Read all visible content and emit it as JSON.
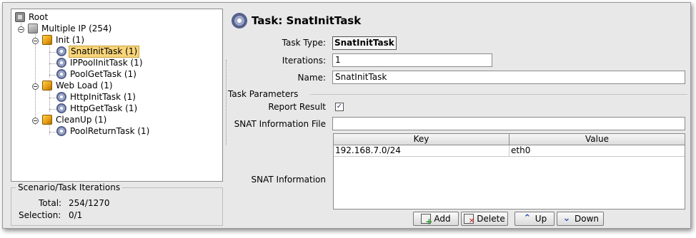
{
  "tree": {
    "root": "Root",
    "scenario": "Multiple IP (254)",
    "groups": [
      {
        "label": "Init (1)",
        "tasks": [
          "SnatInitTask (1)",
          "IPPoolInitTask (1)",
          "PoolGetTask (1)"
        ]
      },
      {
        "label": "Web Load (1)",
        "tasks": [
          "HttpInitTask (1)",
          "HttpGetTask (1)"
        ]
      },
      {
        "label": "CleanUp (1)",
        "tasks": [
          "PoolReturnTask (1)"
        ]
      }
    ],
    "selected": "SnatInitTask (1)"
  },
  "iterations_panel": {
    "title": "Scenario/Task Iterations",
    "total_label": "Total:",
    "total_value": "254/1270",
    "selection_label": "Selection:",
    "selection_value": "0/1"
  },
  "task": {
    "header": "Task: SnatInitTask",
    "type_label": "Task Type:",
    "type_value": "SnatInitTask",
    "iterations_label": "Iterations:",
    "iterations_value": "1",
    "name_label": "Name:",
    "name_value": "SnatInitTask"
  },
  "params": {
    "group_label": "Task Parameters",
    "report_result_label": "Report Result",
    "report_result_checked": true,
    "check_glyph": "✓",
    "snat_file_label": "SNAT Information File",
    "snat_file_value": "",
    "snat_info_label": "SNAT Information",
    "table": {
      "columns": [
        "Key",
        "Value"
      ],
      "rows": [
        [
          "192.168.7.0/24",
          "eth0"
        ]
      ]
    }
  },
  "buttons": {
    "add": "Add",
    "delete": "Delete",
    "up": "Up",
    "down": "Down"
  },
  "icons": {
    "up_glyph": "⌃",
    "down_glyph": "⌄"
  }
}
